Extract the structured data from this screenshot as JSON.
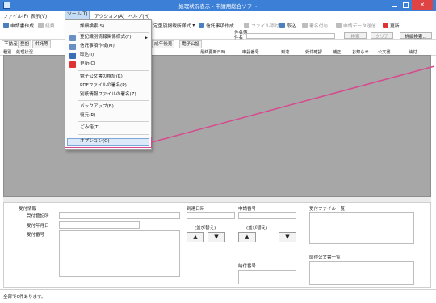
{
  "titlebar": {
    "title": "処理状況表示 - 申請用総合ソフト",
    "close": "✕"
  },
  "menubar": {
    "items": [
      "ファイル(F)",
      "表示(V)",
      "ツール(T)",
      "アクション(A)",
      "ヘルプ(H)"
    ]
  },
  "toolbar": {
    "apply_create": "申請書作成",
    "apply_create2": "経費",
    "format_label": "定型別掲載所様式",
    "receipt_create": "信託事項作成",
    "file_attach": "ファイル添付",
    "take_in": "取込",
    "sign": "署名付与",
    "apply_data": "申請データ送信",
    "update": "更新",
    "case_label1": "件名簿",
    "case_label2": "件名",
    "search": "検索",
    "clear": "クリア",
    "detail_search": "詳細検索..."
  },
  "tabs": [
    "不動産",
    "登記",
    "供託等",
    "成年後見",
    "電子公証"
  ],
  "columns": [
    "種別",
    "処理状況",
    "最終更新日時",
    "申請番号",
    "到達",
    "受付確認",
    "補正",
    "お知らせ",
    "公文書",
    "納付"
  ],
  "dropdown": {
    "items": [
      "詳細検索(S)",
      "登記識別情報関係様式(F)",
      "信託事項作成(M)",
      "取込(I)",
      "更新(C)",
      "電子公文書の検証(K)",
      "PDFファイルの署名(P)",
      "別紙情報ファイルの署名(Z)",
      "バックアップ(B)",
      "復元(R)",
      "ごみ箱(T)",
      "オプション(O)"
    ]
  },
  "detail": {
    "receipt_info": "受付情報",
    "receipt_office": "受付登記所",
    "receipt_date": "受付年月日",
    "receipt_number": "受付番号",
    "arrival_time": "到達日時",
    "apply_number": "申請番号",
    "sort1": "(並び替え)",
    "sort2": "(並び替え)",
    "receipt_file_list": "受付ファイル一覧",
    "public_doc_list": "取得公文書一覧",
    "payment_number": "納付番号",
    "up": "▲",
    "down": "▼"
  },
  "status": {
    "text": "全部で0件あります。"
  }
}
